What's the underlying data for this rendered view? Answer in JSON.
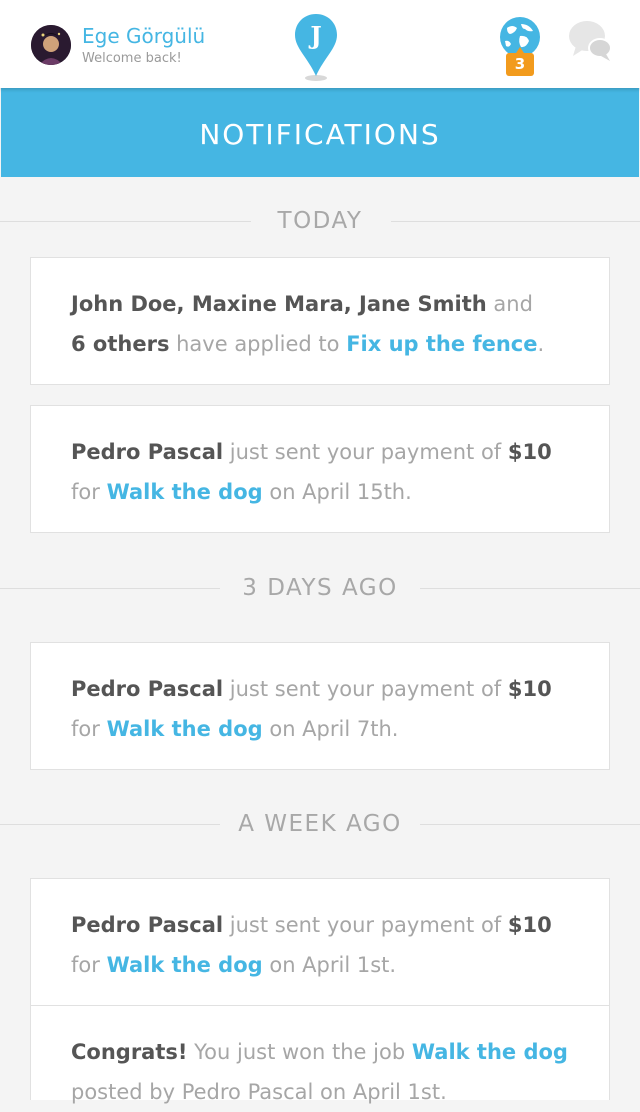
{
  "user": {
    "name": "Ege Görgülü",
    "subtitle": "Welcome back!"
  },
  "logo": {
    "letter": "J"
  },
  "notifications_badge": {
    "count": "3"
  },
  "colors": {
    "accent": "#45b6e3",
    "badge": "#f29b1d",
    "text_dark": "#555555",
    "text_light": "#a6a6a6"
  },
  "icons": {
    "globe": "globe-icon",
    "chat": "chat-bubbles-icon",
    "logo": "map-pin-logo-icon"
  },
  "page": {
    "title": "NOTIFICATIONS"
  },
  "sections": [
    {
      "label": "TODAY"
    },
    {
      "label": "3 DAYS AGO"
    },
    {
      "label": "A WEEK AGO"
    }
  ],
  "cards": [
    {
      "names": "John Doe, Maxine Mara, Jane Smith",
      "and": " and",
      "others": "6 others",
      "middle": " have applied to ",
      "job": "Fix up the fence",
      "end": "."
    },
    {
      "actor": "Pedro Pascal",
      "middle": " just sent your payment of ",
      "amount": "$10",
      "for": "for ",
      "job": "Walk the dog",
      "end": " on April 15th."
    },
    {
      "actor": "Pedro Pascal",
      "middle": " just sent your payment of ",
      "amount": "$10",
      "for": "for ",
      "job": "Walk the dog",
      "end": " on April 7th."
    },
    {
      "actor": "Pedro Pascal",
      "middle": " just sent your payment of ",
      "amount": "$10",
      "for": "for ",
      "job": "Walk the dog",
      "end": " on April 1st."
    },
    {
      "lead": "Congrats!",
      "middle": " You just won the job ",
      "job": "Walk the dog",
      "end": "posted by Pedro Pascal on April 1st."
    }
  ]
}
